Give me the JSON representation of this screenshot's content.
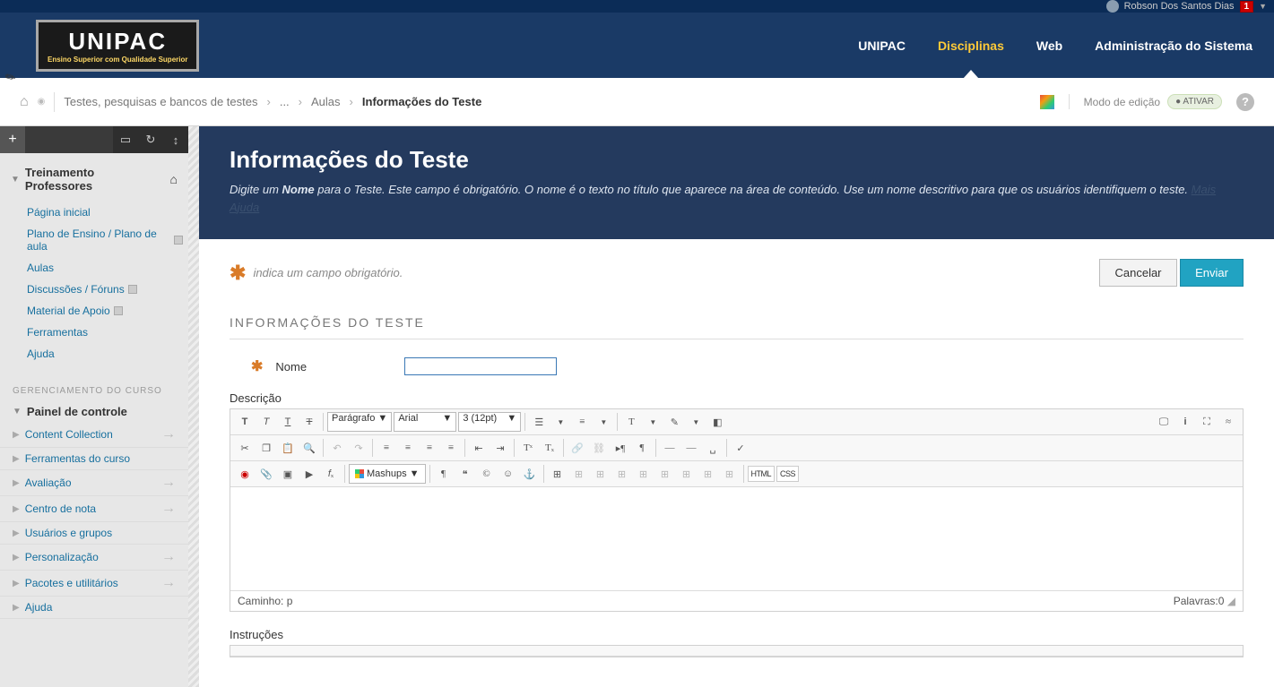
{
  "topbar": {
    "user_name": "Robson Dos Santos Dias",
    "notif_count": "1"
  },
  "logo": {
    "main": "UNIPAC",
    "sub": "Ensino Superior com Qualidade Superior"
  },
  "nav": [
    {
      "label": "UNIPAC",
      "active": false
    },
    {
      "label": "Disciplinas",
      "active": true
    },
    {
      "label": "Web",
      "active": false
    },
    {
      "label": "Administração do Sistema",
      "active": false
    }
  ],
  "breadcrumb": {
    "items": [
      "Testes, pesquisas e bancos de testes",
      "...",
      "Aulas"
    ],
    "current": "Informações do Teste"
  },
  "edit_mode": {
    "label": "Modo de edição",
    "state": "ATIVAR"
  },
  "sidebar": {
    "course_title": "Treinamento Professores",
    "menu": [
      {
        "label": "Página inicial"
      },
      {
        "label": "Plano de Ensino / Plano de aula",
        "badge": true
      },
      {
        "label": "Aulas"
      },
      {
        "label": "Discussões / Fóruns",
        "badge": true
      },
      {
        "label": "Material de Apoio",
        "badge": true
      },
      {
        "label": "Ferramentas"
      },
      {
        "label": "Ajuda"
      }
    ],
    "mgmt_title": "GERENCIAMENTO DO CURSO",
    "cp_title": "Painel de controle",
    "cp": [
      "Content Collection",
      "Ferramentas do curso",
      "Avaliação",
      "Centro de nota",
      "Usuários e grupos",
      "Personalização",
      "Pacotes e utilitários",
      "Ajuda"
    ]
  },
  "main": {
    "title": "Informações do Teste",
    "subtitle_pre": "Digite um ",
    "subtitle_bold": "Nome",
    "subtitle_post": " para o Teste. Este campo é obrigatório. O nome é o texto no título que aparece na área de conteúdo. Use um nome descritivo para que os usuários identifiquem o teste.",
    "more_help": "Mais Ajuda",
    "required_note": "indica um campo obrigatório.",
    "cancel": "Cancelar",
    "submit": "Enviar",
    "section": "INFORMAÇÕES DO TESTE",
    "name_label": "Nome",
    "desc_label": "Descrição",
    "instr_label": "Instruções",
    "editor": {
      "paragraph": "Parágrafo",
      "font": "Arial",
      "size": "3 (12pt)",
      "mashups": "Mashups",
      "html": "HTML",
      "css": "CSS",
      "path_label": "Caminho:",
      "path_value": "p",
      "words_label": "Palavras:",
      "words_value": "0"
    }
  }
}
